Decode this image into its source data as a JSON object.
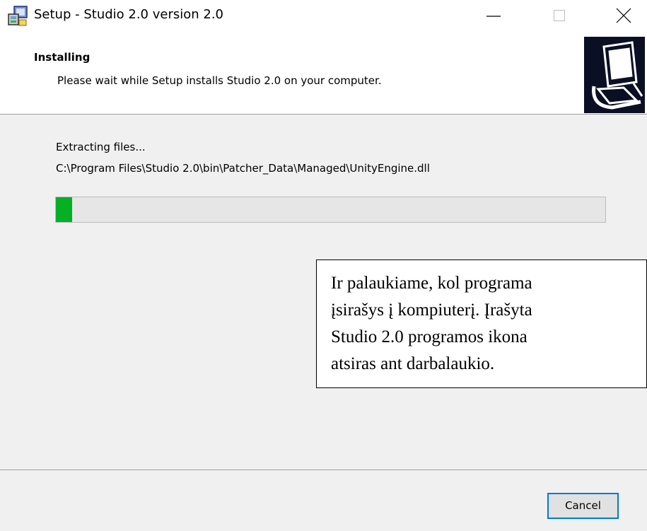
{
  "window": {
    "title": "Setup - Studio 2.0 version 2.0",
    "app_icon": "setup-installer-icon",
    "minimize_icon": "minimize-icon",
    "maximize_icon": "maximize-icon",
    "close_icon": "close-icon"
  },
  "header": {
    "title": "Installing",
    "subtitle": "Please wait while Setup installs Studio 2.0 on your computer.",
    "logo_icon": "computer-setup-logo-icon"
  },
  "content": {
    "status": "Extracting files...",
    "current_file": "C:\\Program Files\\Studio 2.0\\bin\\Patcher_Data\\Managed\\UnityEngine.dll",
    "progress_fraction": 0.03,
    "progress_color": "#06b025"
  },
  "note": {
    "lines": [
      "Ir palaukiame, kol programa",
      "įsirašys į kompiuterį. Įrašyta",
      "Studio 2.0 programos ikona",
      "atsiras ant darbalaukio."
    ]
  },
  "footer": {
    "cancel_label": "Cancel",
    "accent_color": "#0078d7"
  }
}
